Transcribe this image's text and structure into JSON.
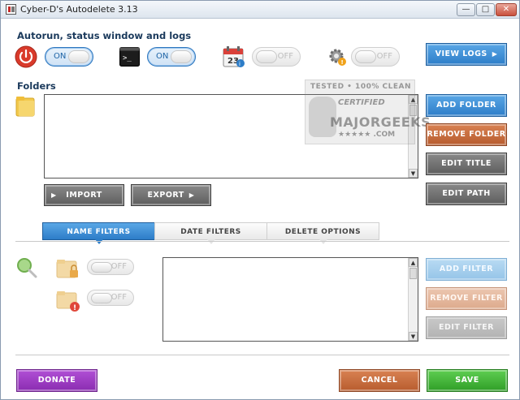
{
  "window": {
    "title": "Cyber-D's Autodelete 3.13",
    "controls": {
      "minimize": "—",
      "maximize": "□",
      "close": "✕"
    }
  },
  "autorun": {
    "heading": "Autorun, status window and logs",
    "toggles": [
      {
        "icon": "power-icon",
        "state": "ON"
      },
      {
        "icon": "terminal-icon",
        "state": "ON"
      },
      {
        "icon": "calendar-icon",
        "state": "OFF"
      },
      {
        "icon": "gear-icon",
        "state": "OFF"
      }
    ],
    "view_logs": "VIEW LOGS"
  },
  "folders": {
    "heading": "Folders",
    "buttons": {
      "add": "ADD FOLDER",
      "remove": "REMOVE FOLDER",
      "edit_title": "EDIT TITLE",
      "edit_path": "EDIT PATH",
      "import": "IMPORT",
      "export": "EXPORT"
    }
  },
  "tabs": [
    "NAME FILTERS",
    "DATE FILTERS",
    "DELETE OPTIONS"
  ],
  "filters": {
    "toggles": [
      {
        "state": "OFF"
      },
      {
        "state": "OFF"
      }
    ],
    "buttons": {
      "add": "ADD FILTER",
      "remove": "REMOVE FILTER",
      "edit": "EDIT FILTER"
    }
  },
  "footer": {
    "donate": "DONATE",
    "cancel": "CANCEL",
    "save": "SAVE"
  },
  "watermark": {
    "line1": "TESTED • 100% CLEAN",
    "line2": "CERTIFIED",
    "line3": "MAJORGEEKS",
    "line4": "★★★★★ .COM"
  },
  "colors": {
    "accent": "#2d7dc8",
    "danger": "#b75c2e",
    "purple": "#8a2cb0",
    "green": "#2f9d27"
  }
}
